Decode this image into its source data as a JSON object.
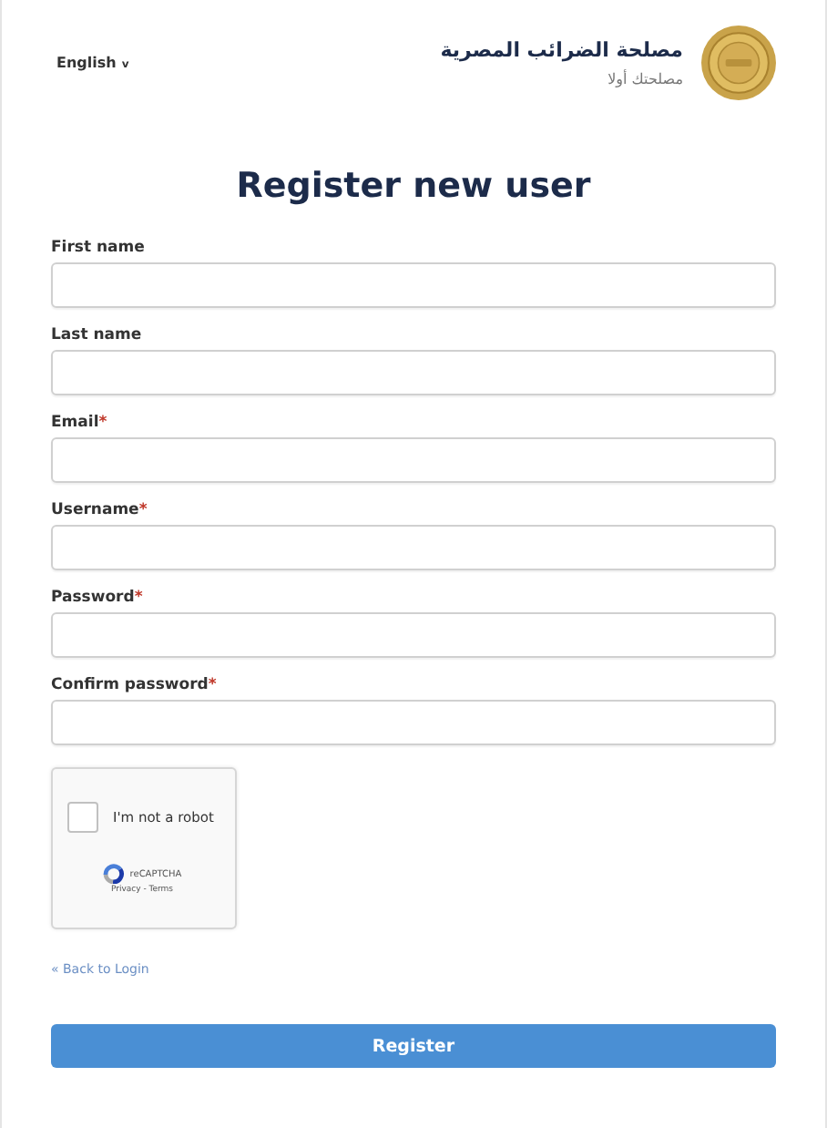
{
  "header": {
    "language": "English",
    "language_caret": "v",
    "org_name": "مصلحة الضرائب المصرية",
    "org_slogan": "مصلحتك أولا"
  },
  "title": "Register new user",
  "fields": [
    {
      "label": "First name"
    },
    {
      "label": "Last name"
    },
    {
      "label": "Email",
      "required_mark": "*"
    },
    {
      "label": "Username",
      "required_mark": "*"
    },
    {
      "label": "Password",
      "required_mark": "*"
    },
    {
      "label": "Confirm password",
      "required_mark": "*"
    }
  ],
  "captcha": {
    "label": "I'm not a robot",
    "checked": false,
    "brand": "reCAPTCHA",
    "links": "Privacy - Terms"
  },
  "back_link": "« Back to Login",
  "submit_button": "Register"
}
